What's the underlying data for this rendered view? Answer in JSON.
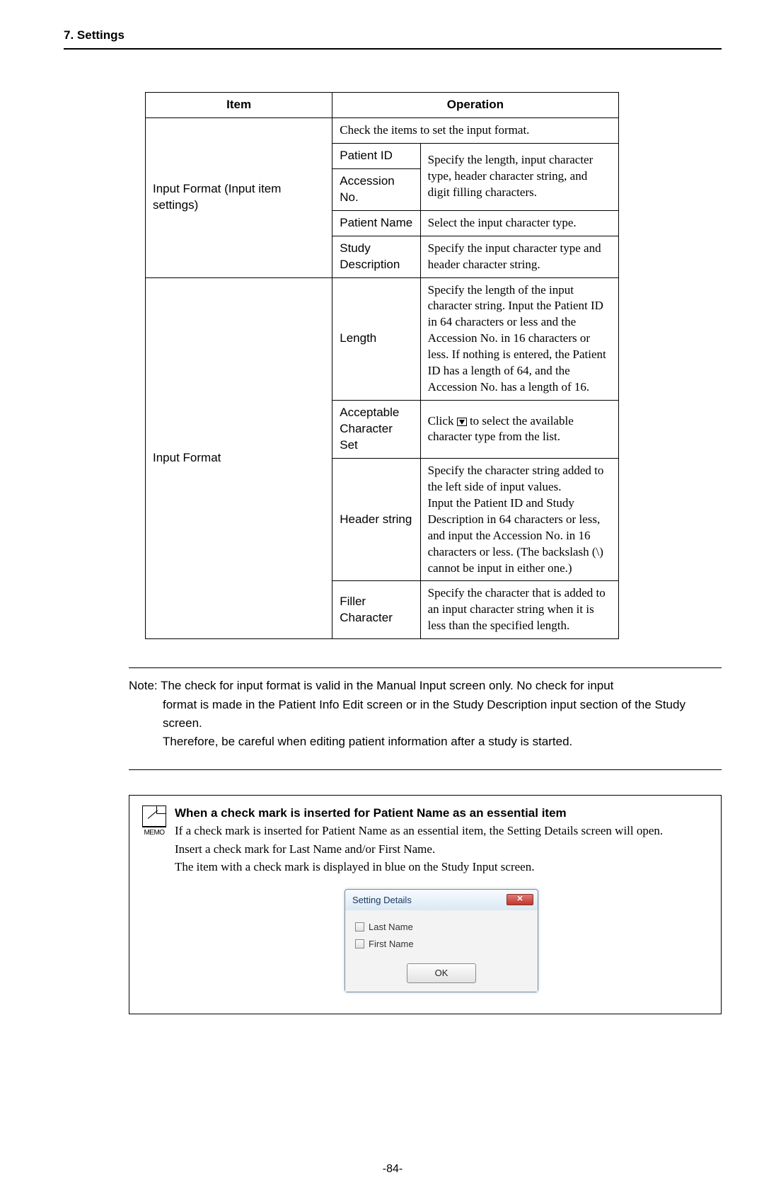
{
  "header": {
    "section": "7. Settings"
  },
  "table": {
    "head": {
      "item": "Item",
      "operation": "Operation"
    },
    "group1": {
      "name": "Input Format (Input item settings)",
      "topnote": "Check the items to set the input format.",
      "rows": [
        {
          "label": "Patient ID",
          "op": "Specify the length, input character type, header character string, and digit filling characters."
        },
        {
          "label": "Accession No."
        },
        {
          "label": "Patient Name",
          "op": "Select the input character type."
        },
        {
          "label": "Study Description",
          "op": "Specify the input character type and header character string."
        }
      ]
    },
    "group2": {
      "name": "Input Format",
      "rows": [
        {
          "label": "Length",
          "op": "Specify the length of the input character string. Input the Patient ID in 64 characters or less and the Accession No. in 16 characters or less. If nothing is entered, the Patient ID has a length of 64, and the Accession No. has a length of 16."
        },
        {
          "label": "Acceptable Character Set",
          "op_pre": "Click ",
          "op_post": " to select the available character type from the list."
        },
        {
          "label": "Header string",
          "op": "Specify the character string added to the left side of input values.\nInput the Patient ID and Study Description in 64 characters or less, and input the Accession No. in 16 characters or less. (The backslash (\\) cannot be input in either one.)"
        },
        {
          "label": "Filler Character",
          "op": "Specify the character that is added to an input character string when it is less than the specified length."
        }
      ]
    }
  },
  "note": {
    "label": "Note:",
    "p1_first": "The check for input format is valid in the Manual Input screen only. No check for input",
    "p1_rest": "format is made in the Patient Info Edit screen or in the Study Description input section of the Study screen.",
    "p2": "Therefore, be careful when editing patient information after a study is started."
  },
  "memo": {
    "icon_label": "MEMO",
    "title": "When a check mark is inserted for Patient Name as an essential item",
    "p1": "If a check mark is inserted for Patient Name as an essential item, the Setting Details screen will open.",
    "p2": "Insert a check mark for Last Name and/or First Name.",
    "p3": "The item with a check mark is displayed in blue on the Study Input screen."
  },
  "dialog": {
    "title": "Setting Details",
    "close": "✕",
    "opt1": "Last Name",
    "opt2": "First Name",
    "ok": "OK"
  },
  "footer": {
    "page": "-84-"
  }
}
